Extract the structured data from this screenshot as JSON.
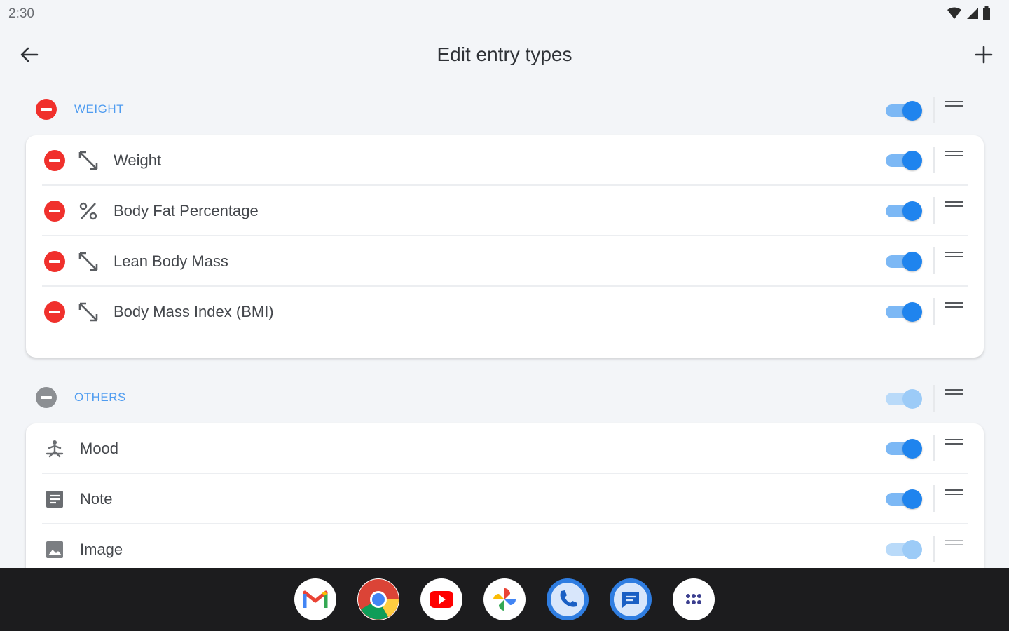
{
  "status_bar": {
    "time": "2:30"
  },
  "app_bar": {
    "title": "Edit entry types"
  },
  "groups": [
    {
      "title": "WEIGHT",
      "enabled": true,
      "items": [
        {
          "label": "Weight",
          "icon": "resize-arrows-icon",
          "enabled": true
        },
        {
          "label": "Body Fat Percentage",
          "icon": "percent-icon",
          "enabled": true
        },
        {
          "label": "Lean Body Mass",
          "icon": "resize-arrows-icon",
          "enabled": true
        },
        {
          "label": "Body Mass Index (BMI)",
          "icon": "resize-arrows-icon",
          "enabled": true
        }
      ]
    },
    {
      "title": "OTHERS",
      "enabled": true,
      "items": [
        {
          "label": "Mood",
          "icon": "meditation-icon",
          "enabled": true
        },
        {
          "label": "Note",
          "icon": "note-icon",
          "enabled": true
        },
        {
          "label": "Image",
          "icon": "image-icon",
          "enabled": true
        }
      ]
    }
  ],
  "dock": [
    "gmail-icon",
    "chrome-icon",
    "youtube-icon",
    "photos-icon",
    "phone-icon",
    "messages-icon",
    "app-drawer-icon"
  ],
  "colors": {
    "accent": "#1f84ee",
    "remove": "#f0302c",
    "section_title": "#4f9cf0",
    "background": "#f3f5f8"
  }
}
